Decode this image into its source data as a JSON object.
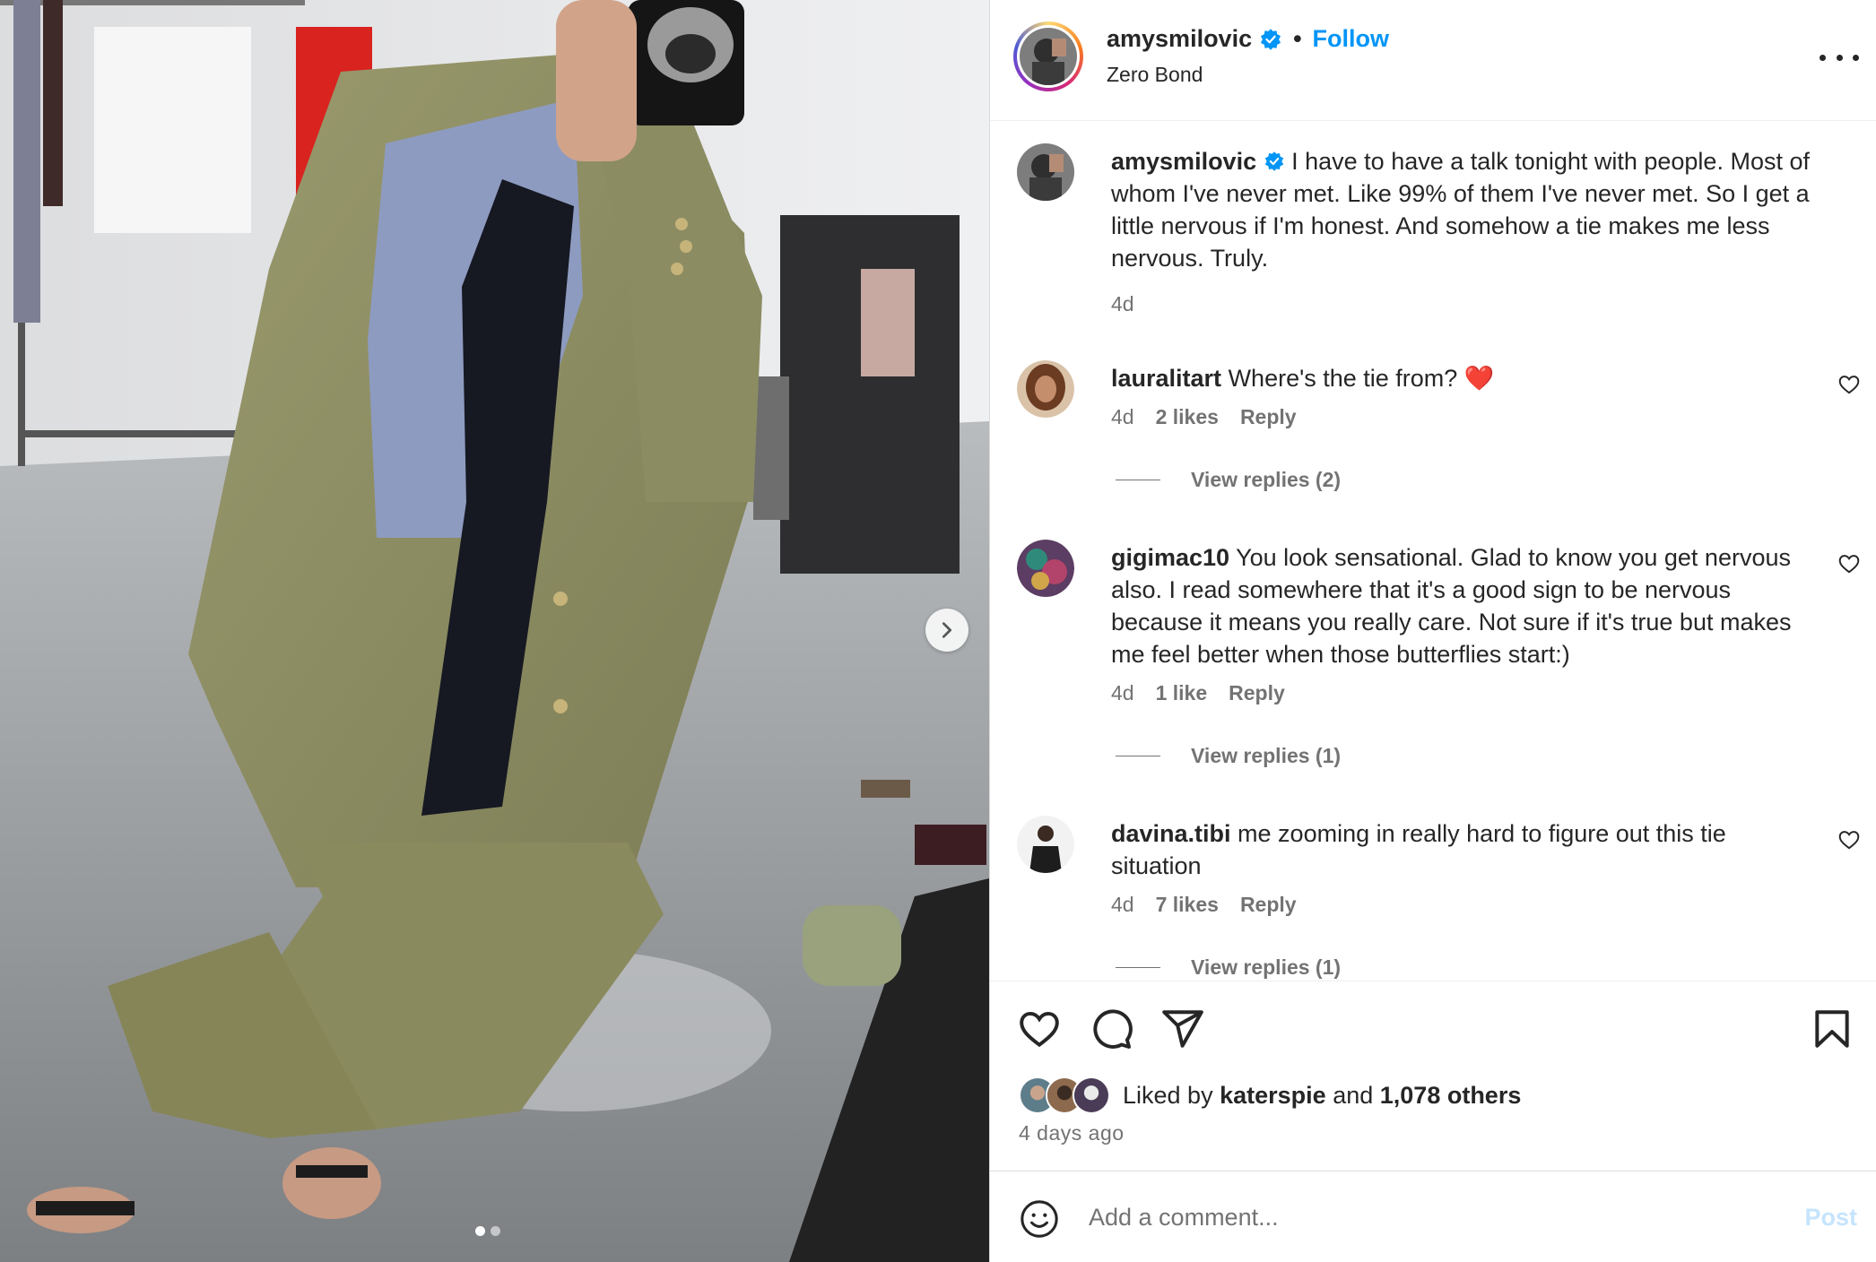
{
  "post": {
    "username": "amysmilovic",
    "follow_label": "Follow",
    "separator": "•",
    "location": "Zero Bond",
    "caption": "I have to have a talk tonight with people. Most of whom I've never met. Like 99% of them I've never met. So I get a little nervous if I'm honest. And somehow a tie makes me less nervous. Truly.",
    "caption_time": "4d",
    "carousel": {
      "slides": 2,
      "active_slide": 1
    }
  },
  "comments": [
    {
      "username": "lauralitart",
      "text": "Where's the tie from? ❤️",
      "time": "4d",
      "likes": "2 likes",
      "reply_label": "Reply",
      "view_replies": "View replies (2)"
    },
    {
      "username": "gigimac10",
      "text": "You look sensational. Glad to know you get nervous also. I read somewhere that it's a good sign to be nervous because it means you really care. Not sure if it's true but makes me feel better when those butterflies start:)",
      "time": "4d",
      "likes": "1 like",
      "reply_label": "Reply",
      "view_replies": "View replies (1)"
    },
    {
      "username": "davina.tibi",
      "text": "me zooming in really hard to figure out this tie situation",
      "time": "4d",
      "likes": "7 likes",
      "reply_label": "Reply",
      "view_replies": "View replies (1)"
    }
  ],
  "likes": {
    "prefix": "Liked by",
    "first_user": "katerspie",
    "conjunction": "and",
    "others": "1,078 others"
  },
  "posted_ago": "4 days ago",
  "composer": {
    "placeholder": "Add a comment...",
    "post_label": "Post"
  },
  "colors": {
    "accent": "#0095f6",
    "text": "#262626",
    "secondary": "#737373",
    "post_disabled": "#c6e4fd",
    "heart_red": "#ed1f2d"
  },
  "icons": [
    "more-options-icon",
    "verified-badge-icon",
    "like-icon",
    "comment-icon",
    "share-icon",
    "save-icon",
    "emoji-icon",
    "chevron-right-icon"
  ]
}
